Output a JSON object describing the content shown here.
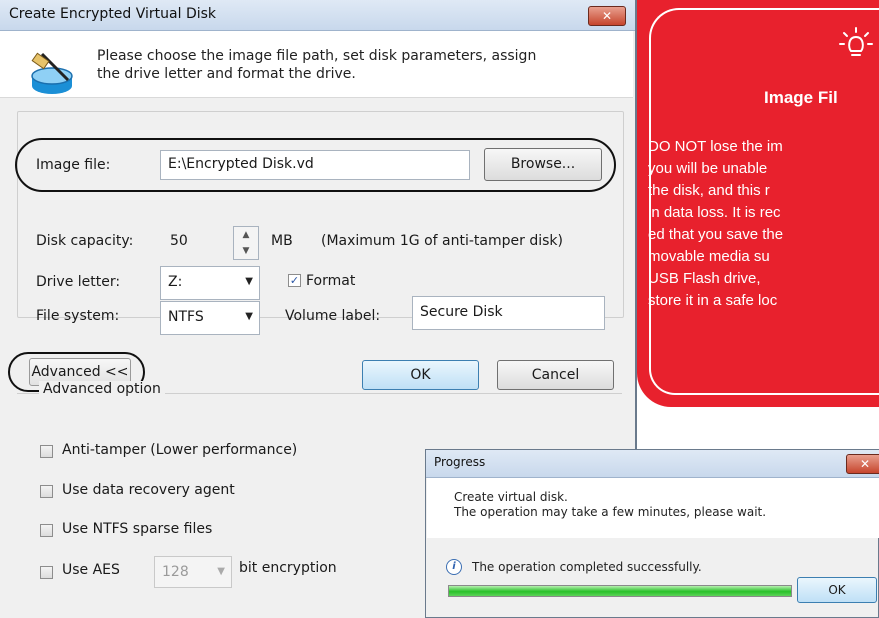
{
  "dialog": {
    "title": "Create Encrypted Virtual Disk",
    "close_glyph": "✕",
    "icon": "disk-wand-icon",
    "intro_line1": "Please choose the image file path, set disk parameters, assign",
    "intro_line2": "the drive letter and format the drive.",
    "image_file_label": "Image file:",
    "image_file_value": "E:\\Encrypted Disk.vd",
    "browse_button": "Browse...",
    "disk_capacity_label": "Disk capacity:",
    "disk_capacity_value": "50",
    "capacity_unit": "MB",
    "capacity_note": "(Maximum 1G of anti-tamper disk)",
    "drive_letter_label": "Drive letter:",
    "drive_letter_value": "Z:",
    "format_label": "Format",
    "format_checked": true,
    "file_system_label": "File system:",
    "file_system_value": "NTFS",
    "volume_label_label": "Volume label:",
    "volume_label_value": "Secure Disk",
    "advanced_button": "Advanced <<",
    "ok_button": "OK",
    "cancel_button": "Cancel",
    "advanced_group_label": "Advanced option",
    "anti_tamper_label": "Anti-tamper (Lower performance)",
    "data_recovery_label": "Use data recovery agent",
    "ntfs_sparse_label": "Use NTFS sparse files",
    "use_aes_label": "Use AES",
    "aes_bits_value": "128",
    "bit_encryption_label": "bit encryption"
  },
  "warning": {
    "icon": "lightbulb-icon",
    "title": "Image Fil",
    "lines": [
      "DO NOT lose the im",
      "you  will  be  unable",
      "the  disk,  and  this  r",
      "in data loss. It is rec",
      "ed that you save the",
      "movable  media  su",
      "USB  Flash  drive,",
      "store it in a safe loc"
    ],
    "bg_color": "#e8212d"
  },
  "progress": {
    "title": "Progress",
    "close_glyph": "✕",
    "message_line1": "Create virtual disk.",
    "message_line2": "The operation may take a few minutes, please wait.",
    "status": "The operation completed successfully.",
    "progress_fraction": 1.0,
    "ok_button": "OK"
  }
}
